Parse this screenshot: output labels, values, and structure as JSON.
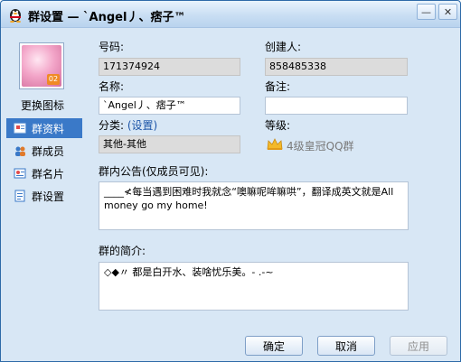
{
  "window": {
    "title": "群设置 — `Angel丿、痞子™"
  },
  "titlebar_buttons": {
    "minimize": "—",
    "close": "✕"
  },
  "left": {
    "change_icon": "更换图标",
    "avatar_badge": "02",
    "nav": [
      {
        "label": "群资料",
        "icon": "group-info-icon",
        "active": true
      },
      {
        "label": "群成员",
        "icon": "members-icon",
        "active": false
      },
      {
        "label": "群名片",
        "icon": "card-icon",
        "active": false
      },
      {
        "label": "群设置",
        "icon": "settings-icon",
        "active": false
      }
    ]
  },
  "form": {
    "number_label": "号码:",
    "number_value": "171374924",
    "creator_label": "创建人:",
    "creator_value": "858485338",
    "name_label": "名称:",
    "name_value": "`Angel丿、痞子™",
    "remark_label": "备注:",
    "remark_value": "",
    "category_label": "分类:",
    "category_link": "(设置)",
    "category_value": "其他-其他",
    "level_label": "等级:",
    "level_value": "4级皇冠QQ群",
    "notice_label": "群内公告(仅成员可见):",
    "notice_value": "____≮每当遇到困难时我就念“噢嘛呢哞嘛哄”，翻译成英文就是All money go my home!",
    "intro_label": "群的简介:",
    "intro_value": "◇◆〃 都是白开水、装啥忧乐美。- .-~"
  },
  "buttons": {
    "ok": "确定",
    "cancel": "取消",
    "apply": "应用"
  },
  "colors": {
    "window_bg": "#d8e7f5",
    "active_nav": "#3a79c8",
    "link": "#1b54a8"
  }
}
